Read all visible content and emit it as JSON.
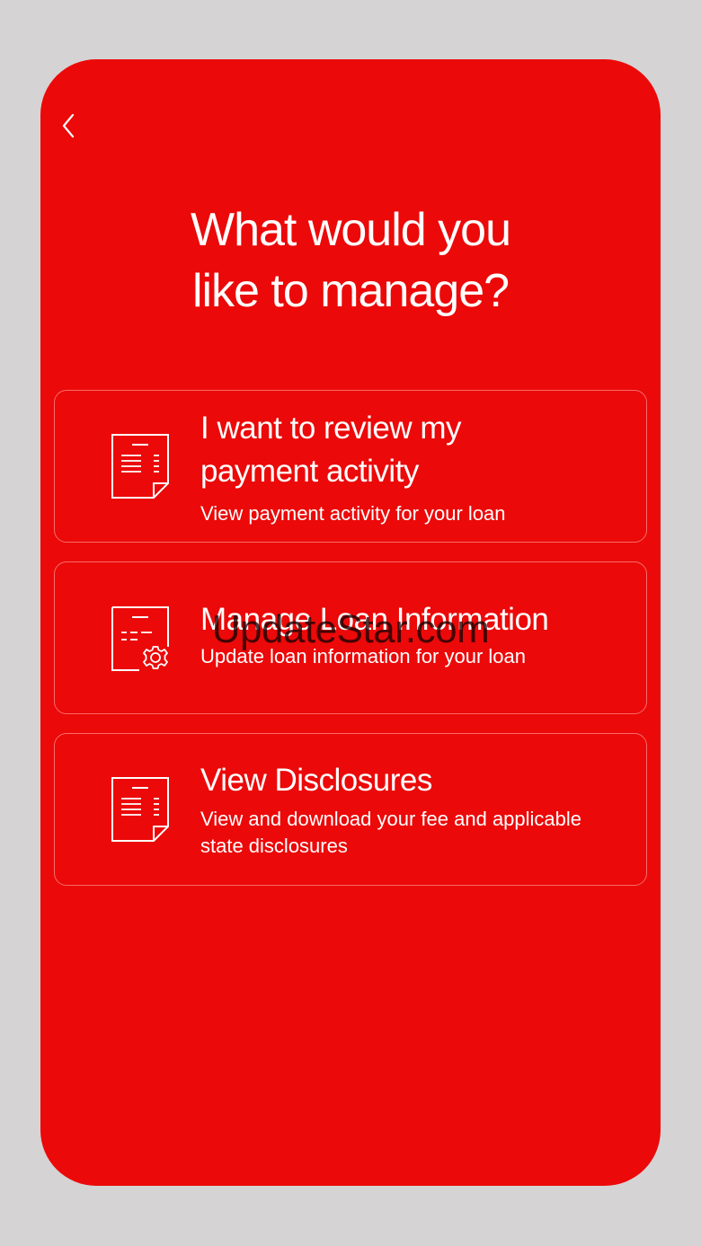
{
  "header": {
    "back_icon": "chevron-left-icon"
  },
  "title": {
    "line1": "What would you",
    "line2": "like to manage?"
  },
  "options": [
    {
      "icon": "document-list-icon",
      "title": "I want to review my payment activity",
      "subtitle": "View payment activity for your loan"
    },
    {
      "icon": "document-settings-icon",
      "title": "Manage Loan Information",
      "subtitle": "Update loan information for your loan"
    },
    {
      "icon": "document-list-icon",
      "title": "View Disclosures",
      "subtitle": "View and download your fee and applicable state disclosures"
    }
  ],
  "watermark": "UpdateStar.com",
  "colors": {
    "background": "#d5d3d4",
    "screen": "#ec0909",
    "text": "#ffffff"
  }
}
